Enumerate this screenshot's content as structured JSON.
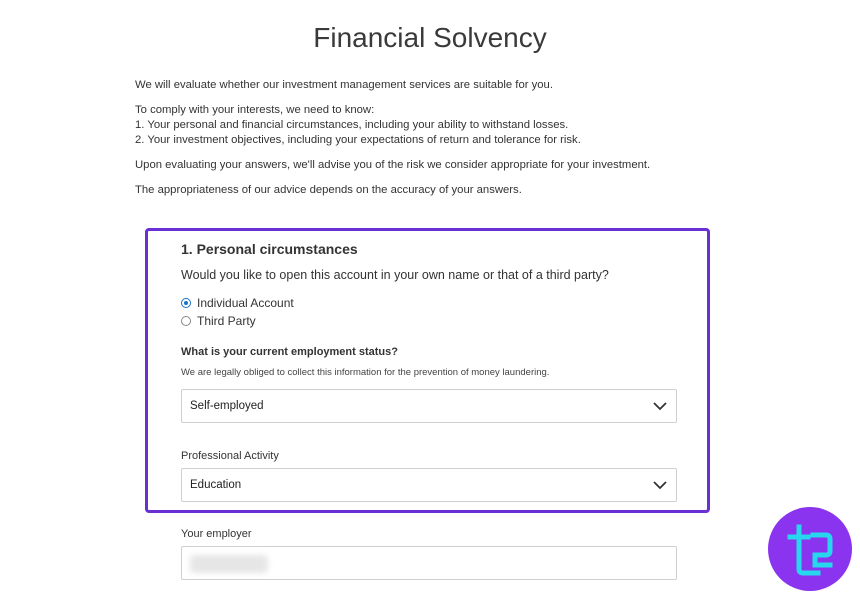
{
  "page": {
    "title": "Financial Solvency"
  },
  "intro": {
    "p1": "We will evaluate whether our investment management services are suitable for you.",
    "p2": "To comply with your interests, we need to know:",
    "list": [
      "1. Your personal and financial circumstances, including your ability to withstand losses.",
      "2. Your investment objectives, including your expectations of return and tolerance for risk."
    ],
    "p3": "Upon evaluating your answers, we'll advise you of the risk we consider appropriate for your investment.",
    "p4": "The appropriateness of our advice depends on the accuracy of your answers."
  },
  "section": {
    "title": "1. Personal circumstances",
    "question": "Would you like to open this account in your own name or that of a third party?",
    "options": [
      {
        "label": "Individual Account",
        "checked": true
      },
      {
        "label": "Third Party",
        "checked": false
      }
    ],
    "employment_label": "What is your current employment status?",
    "employment_hint": "We are legally obliged to collect this information for the prevention of money laundering.",
    "employment_value": "Self-employed",
    "activity_label": "Professional Activity",
    "activity_value": "Education",
    "employer_label": "Your employer"
  },
  "colors": {
    "highlight": "#6b2fd6",
    "radio_accent": "#1a73c9",
    "logo_bg": "#8a34ef",
    "logo_fg": "#27d7ee"
  },
  "icons": {
    "dropdown": "chevron-down-icon",
    "logo": "brand-logo"
  }
}
